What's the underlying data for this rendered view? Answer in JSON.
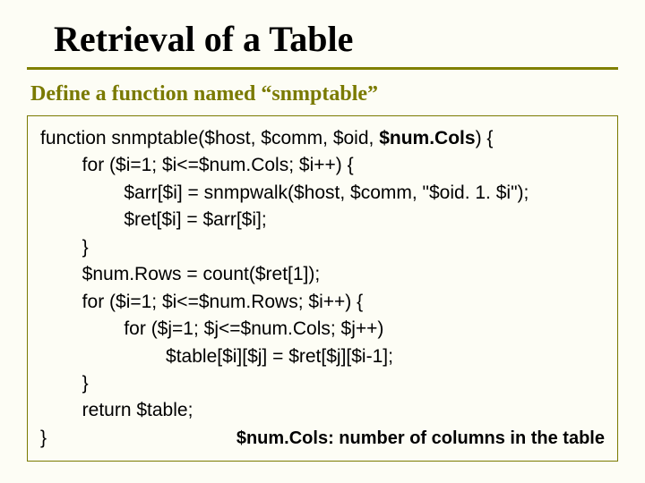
{
  "title": "Retrieval of a Table",
  "subtitle": "Define a function named “snmptable”",
  "code": {
    "l1a": "function snmptable($host, $comm, $oid, ",
    "l1b": "$num.Cols",
    "l1c": ") {",
    "l2": "        for ($i=1; $i<=$num.Cols; $i++) {",
    "l3": "                $arr[$i] = snmpwalk($host, $comm, \"$oid. 1. $i\");",
    "l4": "                $ret[$i] = $arr[$i];",
    "l5": "        }",
    "l6": "        $num.Rows = count($ret[1]);",
    "l7": "        for ($i=1; $i<=$num.Rows; $i++) {",
    "l8": "                for ($j=1; $j<=$num.Cols; $j++)",
    "l9": "                        $table[$i][$j] = $ret[$j][$i-1];",
    "l10": "        }",
    "l11": "        return $table;",
    "l12": "}"
  },
  "note": "$num.Cols: number of columns in the table"
}
